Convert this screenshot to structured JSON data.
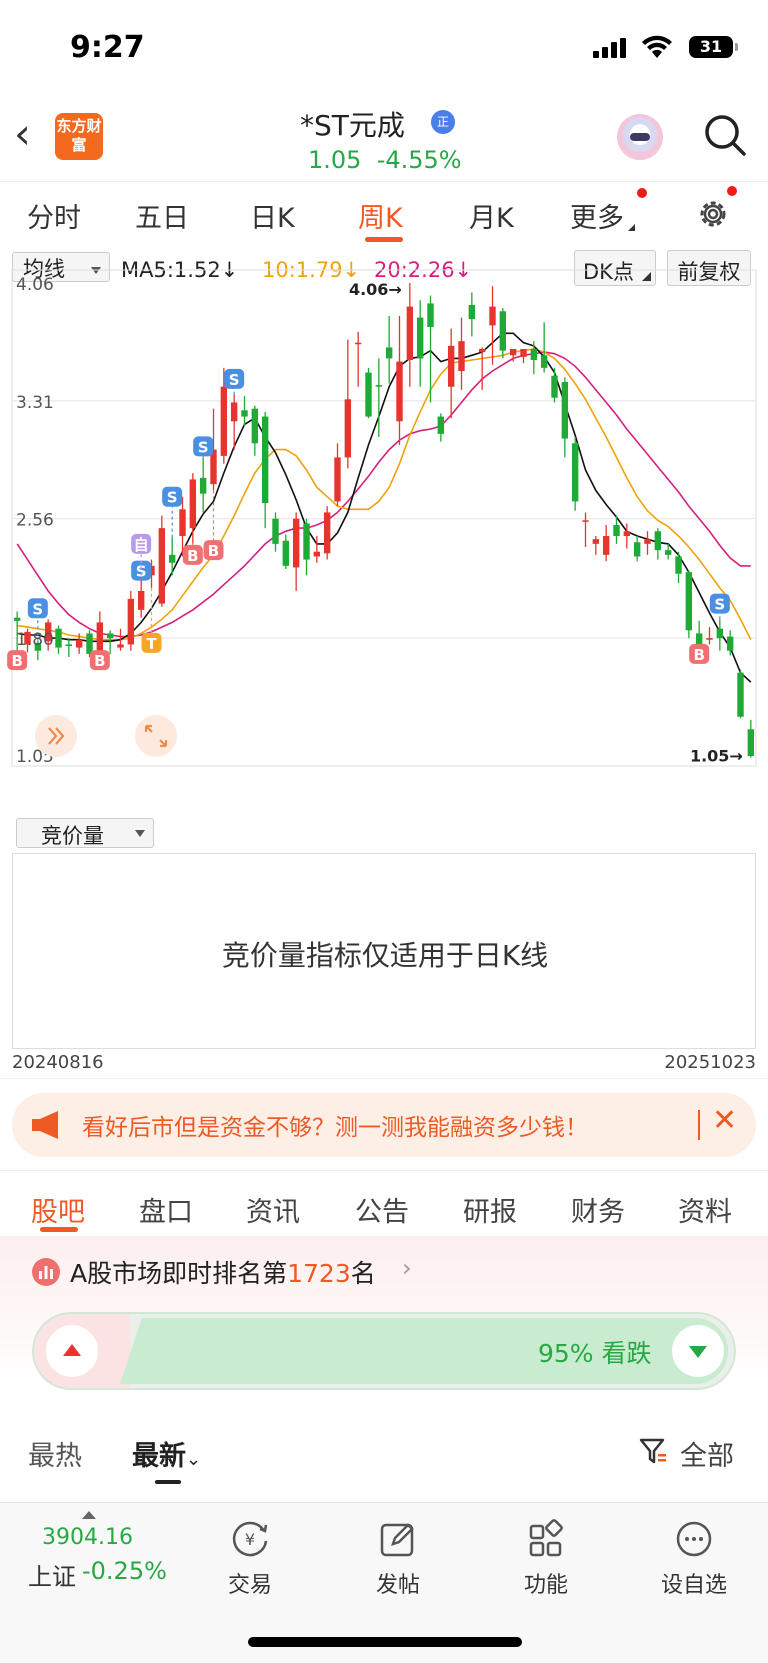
{
  "status": {
    "time": "9:27",
    "battery": "31"
  },
  "header": {
    "logo": "东方财富",
    "title": "*ST元成",
    "badge": "正",
    "price": "1.05",
    "change_pct": "-4.55%"
  },
  "period_tabs": {
    "items": [
      "分时",
      "五日",
      "日K",
      "周K",
      "月K",
      "更多"
    ],
    "selected": "周K"
  },
  "indicator": {
    "main_select": "均线",
    "ma5": "MA5:1.52↓",
    "ma10": "10:1.79↓",
    "ma20": "20:2.26↓",
    "dk_label": "DK点",
    "adjust_label": "前复权",
    "ma5_color": "#111111",
    "ma10_color": "#f0a20c",
    "ma20_color": "#d4207d"
  },
  "chart_data": {
    "type": "candlestick",
    "y_axis_labels": [
      "4.06",
      "3.31",
      "2.56",
      "1.80",
      "1.05"
    ],
    "ylim": [
      1.05,
      4.06
    ],
    "high_marker": "4.06→",
    "low_marker": "1.05→",
    "start_date": "20240816",
    "end_date": "20251023",
    "up_color": "#e8342f",
    "down_color": "#1eaa34",
    "signal_labels": {
      "sell": "S",
      "buy": "B",
      "self": "自",
      "t": "T"
    },
    "candles": [
      [
        1.93,
        1.91,
        1.7,
        1.97
      ],
      [
        1.76,
        1.84,
        1.71,
        1.86
      ],
      [
        1.77,
        1.72,
        1.66,
        1.78
      ],
      [
        1.78,
        1.9,
        1.72,
        1.92
      ],
      [
        1.86,
        1.74,
        1.7,
        1.88
      ],
      [
        1.76,
        1.75,
        1.68,
        1.8
      ],
      [
        1.74,
        1.79,
        1.7,
        1.83
      ],
      [
        1.83,
        1.7,
        1.68,
        1.85
      ],
      [
        1.68,
        1.9,
        1.66,
        1.97
      ],
      [
        1.83,
        1.8,
        1.7,
        1.85
      ],
      [
        1.74,
        1.76,
        1.72,
        1.86
      ],
      [
        1.76,
        2.05,
        1.72,
        2.1
      ],
      [
        1.98,
        2.1,
        1.93,
        2.2
      ],
      [
        2.2,
        2.26,
        2.12,
        2.3
      ],
      [
        2.02,
        2.5,
        2.0,
        2.58
      ],
      [
        2.33,
        2.28,
        2.2,
        2.44
      ],
      [
        2.45,
        2.62,
        2.32,
        2.7
      ],
      [
        2.5,
        2.81,
        2.4,
        2.85
      ],
      [
        2.82,
        2.72,
        2.6,
        2.95
      ],
      [
        2.78,
        3.0,
        2.74,
        3.26
      ],
      [
        2.96,
        3.4,
        2.91,
        3.52
      ],
      [
        3.18,
        3.3,
        3.0,
        3.35
      ],
      [
        3.25,
        3.21,
        3.15,
        3.34
      ],
      [
        3.26,
        3.04,
        2.96,
        3.28
      ],
      [
        3.21,
        2.66,
        2.5,
        3.24
      ],
      [
        2.56,
        2.4,
        2.35,
        2.6
      ],
      [
        2.42,
        2.26,
        2.24,
        2.46
      ],
      [
        2.25,
        2.56,
        2.1,
        2.6
      ],
      [
        2.53,
        2.3,
        2.2,
        2.56
      ],
      [
        2.32,
        2.35,
        2.28,
        2.45
      ],
      [
        2.34,
        2.6,
        2.3,
        2.64
      ],
      [
        2.67,
        2.95,
        2.64,
        3.04
      ],
      [
        2.95,
        3.32,
        2.88,
        3.7
      ],
      [
        3.68,
        3.68,
        3.4,
        3.75
      ],
      [
        3.49,
        3.21,
        3.2,
        3.52
      ],
      [
        3.41,
        3.4,
        3.08,
        3.58
      ],
      [
        3.65,
        3.58,
        3.42,
        3.85
      ],
      [
        3.18,
        3.56,
        3.03,
        3.85
      ],
      [
        3.57,
        3.91,
        3.4,
        4.06
      ],
      [
        3.84,
        3.58,
        3.4,
        3.95
      ],
      [
        3.93,
        3.78,
        3.3,
        3.98
      ],
      [
        3.21,
        3.1,
        3.05,
        3.23
      ],
      [
        3.4,
        3.66,
        3.2,
        3.77
      ],
      [
        3.5,
        3.69,
        3.38,
        3.84
      ],
      [
        3.92,
        3.83,
        3.72,
        4.0
      ],
      [
        3.62,
        3.64,
        3.38,
        3.65
      ],
      [
        3.79,
        3.91,
        3.54,
        4.04
      ],
      [
        3.88,
        3.63,
        3.58,
        3.9
      ],
      [
        3.6,
        3.64,
        3.56,
        3.63
      ],
      [
        3.59,
        3.64,
        3.55,
        3.64
      ],
      [
        3.64,
        3.57,
        3.48,
        3.69
      ],
      [
        3.6,
        3.52,
        3.49,
        3.81
      ],
      [
        3.47,
        3.33,
        3.3,
        3.52
      ],
      [
        3.43,
        3.07,
        2.95,
        3.46
      ],
      [
        3.04,
        2.67,
        2.61,
        3.08
      ],
      [
        2.55,
        2.55,
        2.38,
        2.6
      ],
      [
        2.4,
        2.43,
        2.33,
        2.45
      ],
      [
        2.33,
        2.45,
        2.29,
        2.52
      ],
      [
        2.52,
        2.45,
        2.4,
        2.58
      ],
      [
        2.45,
        2.48,
        2.37,
        2.53
      ],
      [
        2.41,
        2.32,
        2.29,
        2.45
      ],
      [
        2.4,
        2.43,
        2.33,
        2.48
      ],
      [
        2.48,
        2.36,
        2.3,
        2.5
      ],
      [
        2.36,
        2.33,
        2.3,
        2.4
      ],
      [
        2.32,
        2.21,
        2.15,
        2.35
      ],
      [
        2.22,
        1.85,
        1.8,
        2.23
      ],
      [
        1.83,
        1.76,
        1.74,
        1.91
      ],
      [
        1.79,
        1.8,
        1.76,
        1.87
      ],
      [
        1.86,
        1.8,
        1.72,
        1.92
      ],
      [
        1.81,
        1.72,
        1.69,
        1.85
      ],
      [
        1.58,
        1.3,
        1.29,
        1.6
      ],
      [
        1.22,
        1.05,
        1.04,
        1.28
      ]
    ],
    "ma5": [
      1.83,
      1.82,
      1.82,
      1.8,
      1.8,
      1.79,
      1.79,
      1.78,
      1.78,
      1.78,
      1.79,
      1.83,
      1.9,
      1.99,
      2.1,
      2.22,
      2.35,
      2.48,
      2.59,
      2.67,
      2.85,
      3.02,
      3.16,
      3.2,
      3.08,
      2.98,
      2.84,
      2.68,
      2.5,
      2.4,
      2.4,
      2.47,
      2.6,
      2.82,
      3.03,
      3.21,
      3.4,
      3.53,
      3.58,
      3.59,
      3.63,
      3.56,
      3.58,
      3.58,
      3.6,
      3.62,
      3.68,
      3.74,
      3.74,
      3.68,
      3.66,
      3.59,
      3.49,
      3.29,
      3.09,
      2.87,
      2.74,
      2.65,
      2.57,
      2.48,
      2.45,
      2.43,
      2.41,
      2.4,
      2.33,
      2.22,
      2.09,
      1.96,
      1.84,
      1.74,
      1.58,
      1.52
    ],
    "ma10": [
      1.88,
      1.87,
      1.86,
      1.85,
      1.84,
      1.82,
      1.81,
      1.8,
      1.79,
      1.79,
      1.79,
      1.8,
      1.83,
      1.87,
      1.92,
      1.98,
      2.07,
      2.16,
      2.25,
      2.33,
      2.45,
      2.58,
      2.72,
      2.85,
      2.94,
      3.0,
      3.0,
      2.96,
      2.87,
      2.76,
      2.7,
      2.64,
      2.62,
      2.62,
      2.62,
      2.67,
      2.76,
      2.91,
      3.09,
      3.24,
      3.38,
      3.48,
      3.55,
      3.56,
      3.57,
      3.58,
      3.59,
      3.6,
      3.62,
      3.63,
      3.64,
      3.62,
      3.58,
      3.51,
      3.42,
      3.32,
      3.2,
      3.08,
      2.95,
      2.82,
      2.7,
      2.61,
      2.55,
      2.51,
      2.45,
      2.38,
      2.3,
      2.21,
      2.12,
      2.04,
      1.92,
      1.79
    ],
    "ma20": [
      2.4,
      2.3,
      2.2,
      2.1,
      2.02,
      1.95,
      1.9,
      1.86,
      1.83,
      1.82,
      1.81,
      1.81,
      1.82,
      1.84,
      1.87,
      1.9,
      1.94,
      1.98,
      2.03,
      2.08,
      2.14,
      2.2,
      2.26,
      2.33,
      2.4,
      2.45,
      2.48,
      2.5,
      2.5,
      2.52,
      2.55,
      2.6,
      2.67,
      2.75,
      2.83,
      2.92,
      3.0,
      3.06,
      3.1,
      3.12,
      3.13,
      3.15,
      3.22,
      3.3,
      3.38,
      3.45,
      3.5,
      3.54,
      3.58,
      3.6,
      3.61,
      3.62,
      3.61,
      3.58,
      3.53,
      3.46,
      3.38,
      3.3,
      3.22,
      3.13,
      3.05,
      2.97,
      2.89,
      2.81,
      2.73,
      2.64,
      2.56,
      2.48,
      2.39,
      2.31,
      2.26,
      2.26
    ],
    "signals": [
      {
        "type": "B",
        "i": 0,
        "v": 1.66
      },
      {
        "type": "S",
        "i": 2,
        "v": 1.99
      },
      {
        "type": "B",
        "i": 8,
        "v": 1.66
      },
      {
        "type": "T",
        "i": 13,
        "v": 1.77
      },
      {
        "type": "S",
        "i": 12,
        "v": 2.23
      },
      {
        "type": "自",
        "i": 12,
        "v": 2.4
      },
      {
        "type": "B",
        "i": 17,
        "v": 2.33
      },
      {
        "type": "B",
        "i": 19,
        "v": 2.36
      },
      {
        "type": "S",
        "i": 15,
        "v": 2.7
      },
      {
        "type": "S",
        "i": 18,
        "v": 3.02
      },
      {
        "type": "S",
        "i": 21,
        "v": 3.45
      },
      {
        "type": "B",
        "i": 66,
        "v": 1.7
      },
      {
        "type": "S",
        "i": 68,
        "v": 2.02
      }
    ]
  },
  "volume_panel": {
    "select": "竞价量",
    "message": "竞价量指标仅适用于日K线",
    "start_date": "20240816",
    "end_date": "20251023"
  },
  "promo": {
    "text": "看好后市但是资金不够？测一测我能融资多少钱！",
    "close": "✕"
  },
  "content_tabs": {
    "items": [
      "股吧",
      "盘口",
      "资讯",
      "公告",
      "研报",
      "财务",
      "资料"
    ],
    "selected": "股吧"
  },
  "rank": {
    "prefix": "A股市场即时排名第",
    "number": "1723",
    "suffix": "名"
  },
  "vote": {
    "text": "95% 看跌",
    "down_pct": 0.95
  },
  "sort": {
    "hot": "最热",
    "latest": "最新",
    "filter_all": "全部"
  },
  "bottom_bar": {
    "index_value": "3904.16",
    "index_name": "上证",
    "index_change": "-0.25%",
    "nav": [
      "交易",
      "发帖",
      "功能",
      "设自选"
    ]
  }
}
